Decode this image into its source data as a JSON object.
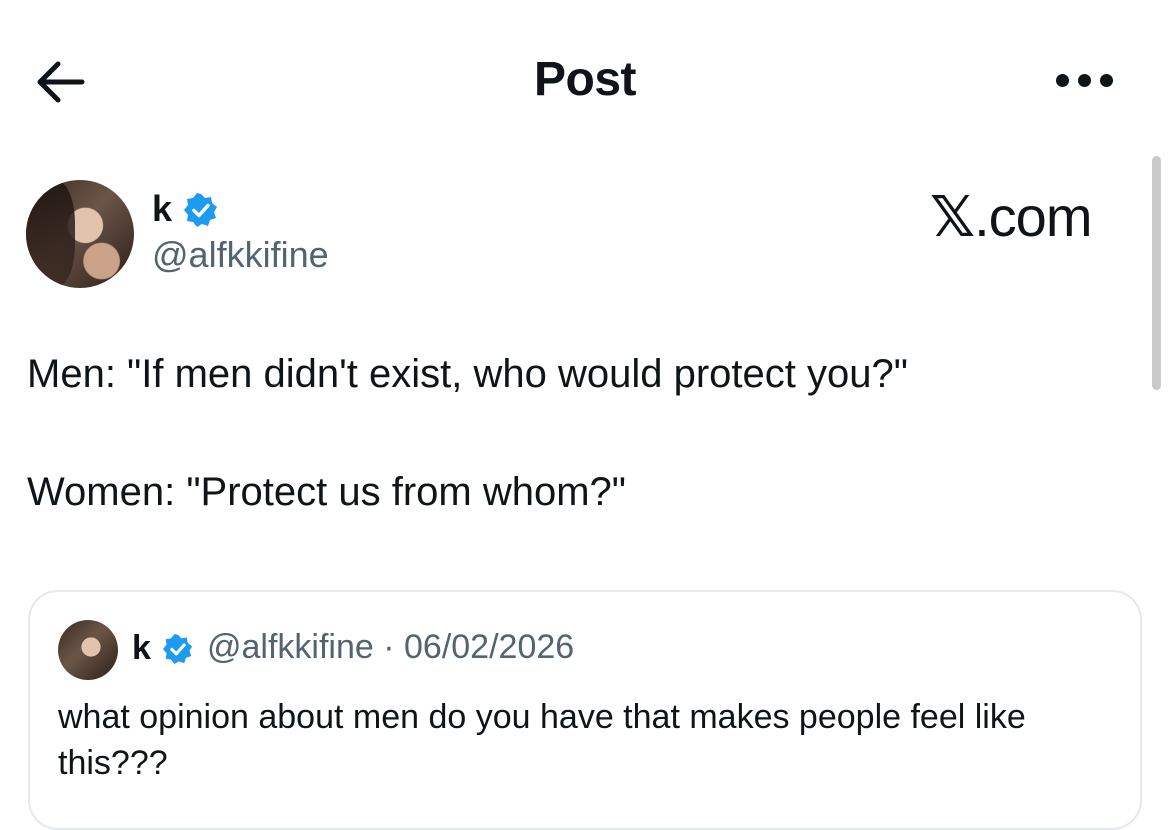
{
  "header": {
    "title": "Post",
    "back_icon": "arrow-left-icon",
    "more_icon": "more-horizontal-icon"
  },
  "post": {
    "author": {
      "display_name": "k",
      "handle": "@alfkkifine",
      "verified_icon": "verified-badge-icon"
    },
    "watermark": {
      "x_glyph": "𝕏",
      "text": ".com"
    },
    "text_lines": [
      "Men: \"If men didn't exist, who would protect you?\"",
      "Women: \"Protect us from whom?\""
    ]
  },
  "quote": {
    "display_name": "k",
    "meta": "@alfkkifine · 06/02/2026",
    "text": "what opinion about men do you have that makes people feel like this???"
  },
  "colors": {
    "text": "#0f1419",
    "secondary": "#536471",
    "verified": "#1d9bf0",
    "border": "#e6e9ec"
  }
}
